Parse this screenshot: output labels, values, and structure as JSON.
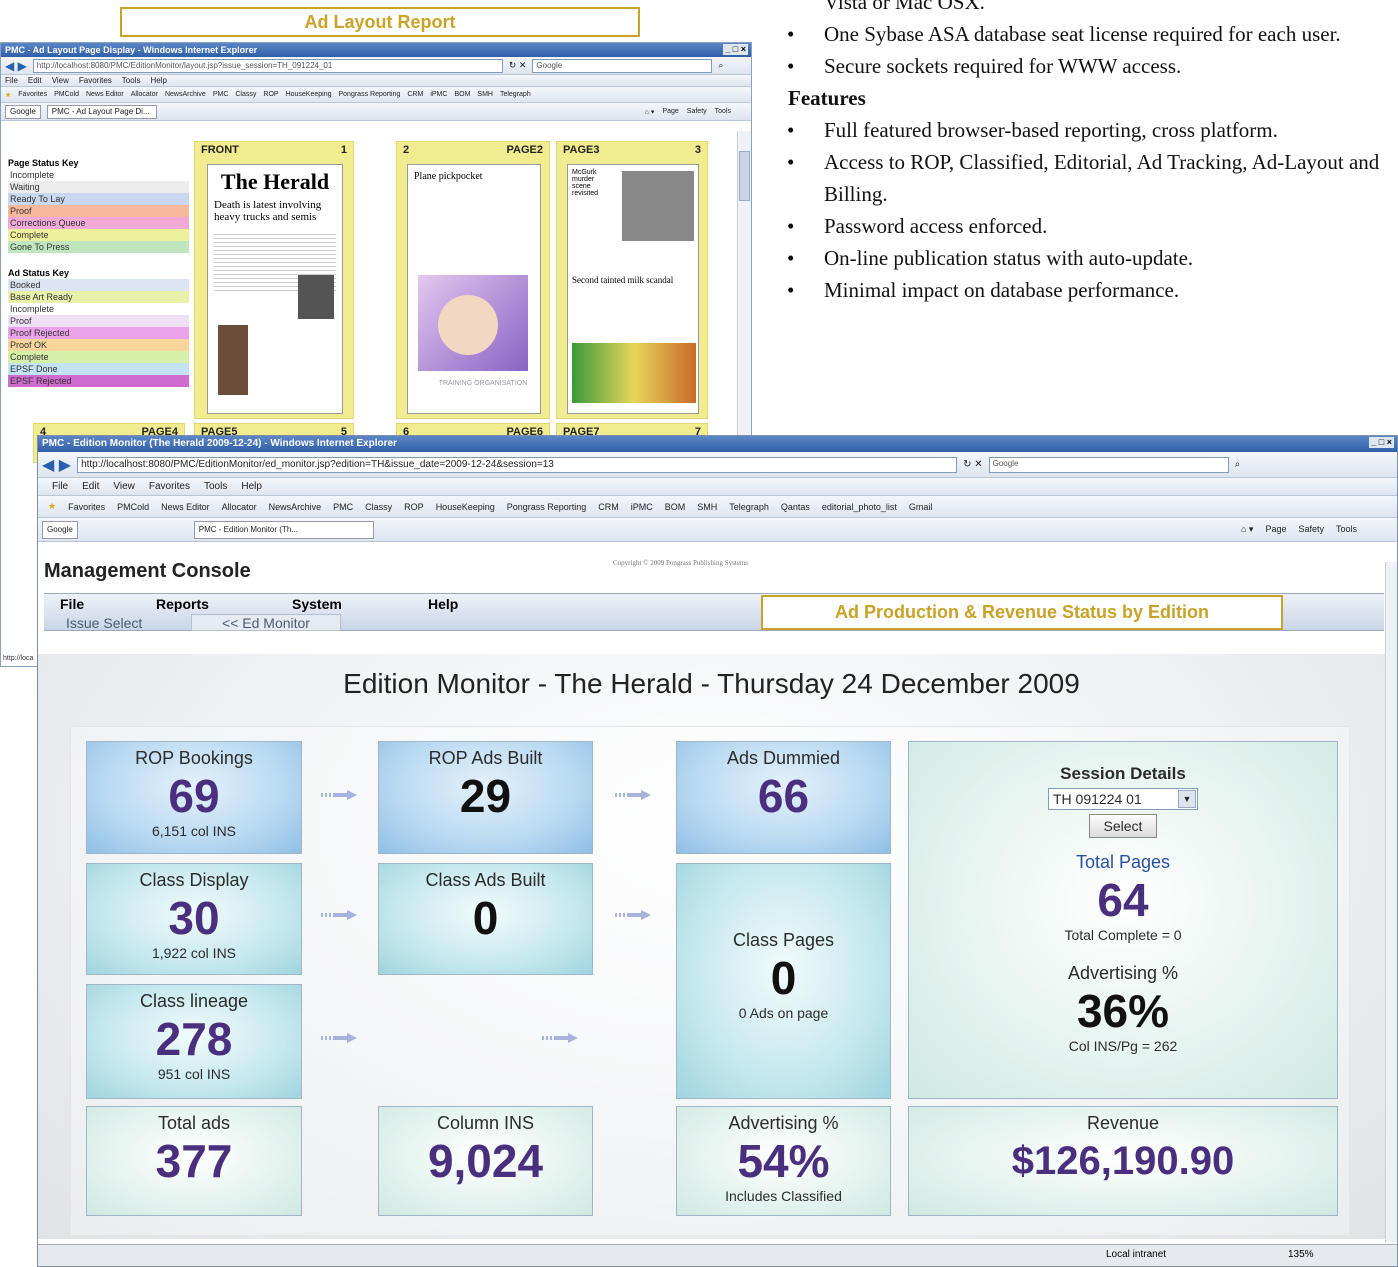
{
  "callouts": {
    "ad_layout": "Ad Layout Report",
    "ad_production": "Ad Production & Revenue Status  by Edition"
  },
  "features": {
    "line_top": "Vista or Mac OSX.",
    "req_bullets": [
      "One Sybase ASA database seat license required for each user.",
      "Secure sockets required for WWW access."
    ],
    "heading": "Features",
    "bullets": [
      "Full featured browser-based reporting, cross platform.",
      "Access to ROP, Classified, Editorial, Ad Tracking, Ad-Layout and Billing.",
      "Password access enforced.",
      "On-line publication status with auto-update.",
      "Minimal impact on database performance."
    ]
  },
  "win1": {
    "title": "PMC - Ad Layout Page Display - Windows Internet Explorer",
    "address": "http://localhost:8080/PMC/EditionMonitor/layout.jsp?issue_session=TH_091224_01",
    "search": "Google",
    "menu": [
      "File",
      "Edit",
      "View",
      "Favorites",
      "Tools",
      "Help"
    ],
    "favorites": [
      "Favorites",
      "PMCold",
      "News Editor",
      "Allocator",
      "NewsArchive",
      "PMC",
      "Classy",
      "ROP",
      "HouseKeeping",
      "Pongrass Reporting",
      "CRM",
      "iPMC",
      "BOM",
      "SMH",
      "Telegraph"
    ],
    "tab": "PMC - Ad Layout Page Di...",
    "tab_google": "Google",
    "tools": [
      "Page",
      "Safety",
      "Tools"
    ],
    "page_key": {
      "title": "Page Status Key",
      "items": [
        {
          "label": "Incomplete",
          "color": "#ffffff"
        },
        {
          "label": "Waiting",
          "color": "#ececec"
        },
        {
          "label": "Ready To Lay",
          "color": "#c9d8f0"
        },
        {
          "label": "Proof",
          "color": "#f7b99b"
        },
        {
          "label": "Corrections Queue",
          "color": "#f1a9d6"
        },
        {
          "label": "Complete",
          "color": "#eef19b"
        },
        {
          "label": "Gone To Press",
          "color": "#bfe6bf"
        }
      ]
    },
    "ad_key": {
      "title": "Ad Status Key",
      "items": [
        {
          "label": "Booked",
          "color": "#dde4f5"
        },
        {
          "label": "Base Art Ready",
          "color": "#e8f0a9"
        },
        {
          "label": "Incomplete",
          "color": "#ffffff"
        },
        {
          "label": "Proof",
          "color": "#efe0f5"
        },
        {
          "label": "Proof Rejected",
          "color": "#eaa3ea"
        },
        {
          "label": "Proof OK",
          "color": "#f7d69c"
        },
        {
          "label": "Complete",
          "color": "#d7f0a9"
        },
        {
          "label": "EPSF Done",
          "color": "#c3e3f3"
        },
        {
          "label": "EPSF Rejected",
          "color": "#d06bd0"
        }
      ]
    },
    "pages_row1": [
      {
        "left": "FRONT",
        "right": "1",
        "headline": "Death is latest involving heavy trucks and semis",
        "masthead": "The Herald"
      },
      {
        "left": "2",
        "right": "PAGE2",
        "headline": "Plane pickpocket",
        "sub": "TRAINING ORGANISATION"
      },
      {
        "left": "PAGE3",
        "right": "3",
        "headline": "Second tainted milk scandal",
        "sub": "McGurk murder scene revisited"
      }
    ],
    "pages_row2": [
      {
        "left": "4",
        "right": "PAGE4"
      },
      {
        "left": "PAGE5",
        "right": "5"
      },
      {
        "left": "6",
        "right": "PAGE6"
      },
      {
        "left": "PAGE7",
        "right": "7"
      }
    ],
    "status": "http://loca"
  },
  "win2": {
    "title": "PMC - Edition Monitor (The Herald 2009-12-24) - Windows Internet Explorer",
    "address": "http://localhost:8080/PMC/EditionMonitor/ed_monitor.jsp?edition=TH&issue_date=2009-12-24&session=13",
    "search": "Google",
    "menu": [
      "File",
      "Edit",
      "View",
      "Favorites",
      "Tools",
      "Help"
    ],
    "favorites": [
      "Favorites",
      "PMCold",
      "News Editor",
      "Allocator",
      "NewsArchive",
      "PMC",
      "Classy",
      "ROP",
      "HouseKeeping",
      "Pongrass Reporting",
      "CRM",
      "iPMC",
      "BOM",
      "SMH",
      "Telegraph",
      "Qantas",
      "editorial_photo_list",
      "Gmail"
    ],
    "tab_google": "Google",
    "tab": "PMC - Edition Monitor (Th...",
    "tools": [
      "Page",
      "Safety",
      "Tools"
    ],
    "console_title": "Management Console",
    "copyright": "Copyright © 2009 Pongrass Publishing Systems",
    "app_menu": [
      "File",
      "Reports",
      "System",
      "Help"
    ],
    "sub_nav": [
      "Issue Select",
      "<< Ed Monitor"
    ],
    "heading": "Edition Monitor - The Herald - Thursday 24 December 2009",
    "tiles": {
      "rop_bookings": {
        "label": "ROP Bookings",
        "value": "69",
        "sub": "6,151 col INS"
      },
      "rop_ads_built": {
        "label": "ROP Ads Built",
        "value": "29"
      },
      "ads_dummied": {
        "label": "Ads Dummied",
        "value": "66"
      },
      "class_display": {
        "label": "Class Display",
        "value": "30",
        "sub": "1,922 col INS"
      },
      "class_ads_built": {
        "label": "Class Ads Built",
        "value": "0"
      },
      "class_pages": {
        "label": "Class Pages",
        "value": "0",
        "sub": "0 Ads on page"
      },
      "class_lineage": {
        "label": "Class lineage",
        "value": "278",
        "sub": "951 col INS"
      },
      "total_ads": {
        "label": "Total ads",
        "value": "377"
      },
      "column_ins": {
        "label": "Column INS",
        "value": "9,024"
      },
      "advertising_pct": {
        "label": "Advertising %",
        "value": "54%",
        "sub": "Includes Classified"
      },
      "revenue": {
        "label": "Revenue",
        "value": "$126,190.90"
      }
    },
    "session": {
      "title": "Session Details",
      "selected": "TH 091224 01",
      "button": "Select",
      "total_pages_label": "Total Pages",
      "total_pages": "64",
      "total_complete": "Total Complete = 0",
      "adv_label": "Advertising %",
      "adv_value": "36%",
      "col_ins_pg": "Col INS/Pg = 262"
    },
    "status": {
      "zone": "Local intranet",
      "zoom": "135%"
    }
  },
  "colors": {
    "callout": "#c9a227",
    "big_number": "#4a2f7e",
    "page_card": "#f1ec8f"
  }
}
